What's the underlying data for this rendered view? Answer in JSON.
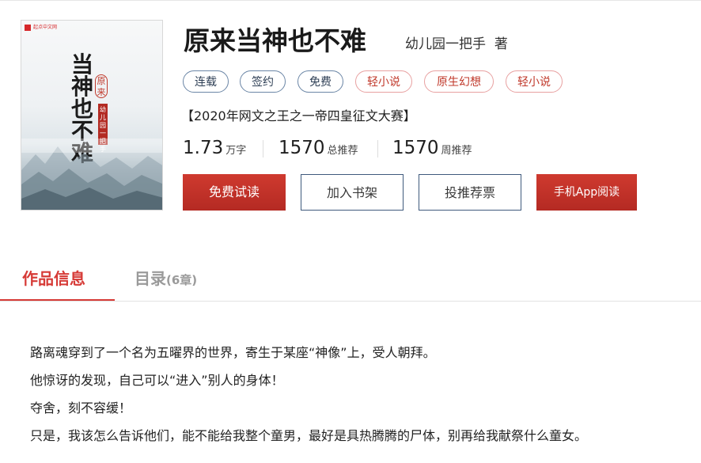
{
  "cover": {
    "publisher_badge": "起点中文网",
    "title_vertical": "当神也不难",
    "seal_text": "原来",
    "author_tag": "幼儿园一把手"
  },
  "book": {
    "title": "原来当神也不难",
    "author": "幼儿园一把手",
    "author_suffix": "著",
    "tags": [
      {
        "label": "连载",
        "style": "blue"
      },
      {
        "label": "签约",
        "style": "blue"
      },
      {
        "label": "免费",
        "style": "blue"
      },
      {
        "label": "轻小说",
        "style": "red"
      },
      {
        "label": "原生幻想",
        "style": "red"
      },
      {
        "label": "轻小说",
        "style": "red"
      }
    ],
    "contest": "【2020年网文之王之一帝四皇征文大赛】",
    "stats": [
      {
        "value": "1.73",
        "unit": "万字"
      },
      {
        "value": "1570",
        "unit": "总推荐"
      },
      {
        "value": "1570",
        "unit": "周推荐"
      }
    ]
  },
  "actions": {
    "read_free": "免费试读",
    "add_shelf": "加入书架",
    "vote": "投推荐票",
    "app_read": "手机App阅读"
  },
  "tabs": {
    "info": "作品信息",
    "catalog": "目录",
    "catalog_count": "(6章)"
  },
  "intro": [
    "路离魂穿到了一个名为五曜界的世界，寄生于某座“神像”上，受人朝拜。",
    "他惊讶的发现，自己可以“进入”别人的身体！",
    "夺舍，刻不容缓！",
    "只是，我该怎么告诉他们，能不能给我整个童男，最好是具热腾腾的尸体，别再给我献祭什么童女。"
  ],
  "colors": {
    "accent_red": "#d63a36",
    "button_red": "#c0322a",
    "outline_blue": "#3f5a7d"
  }
}
